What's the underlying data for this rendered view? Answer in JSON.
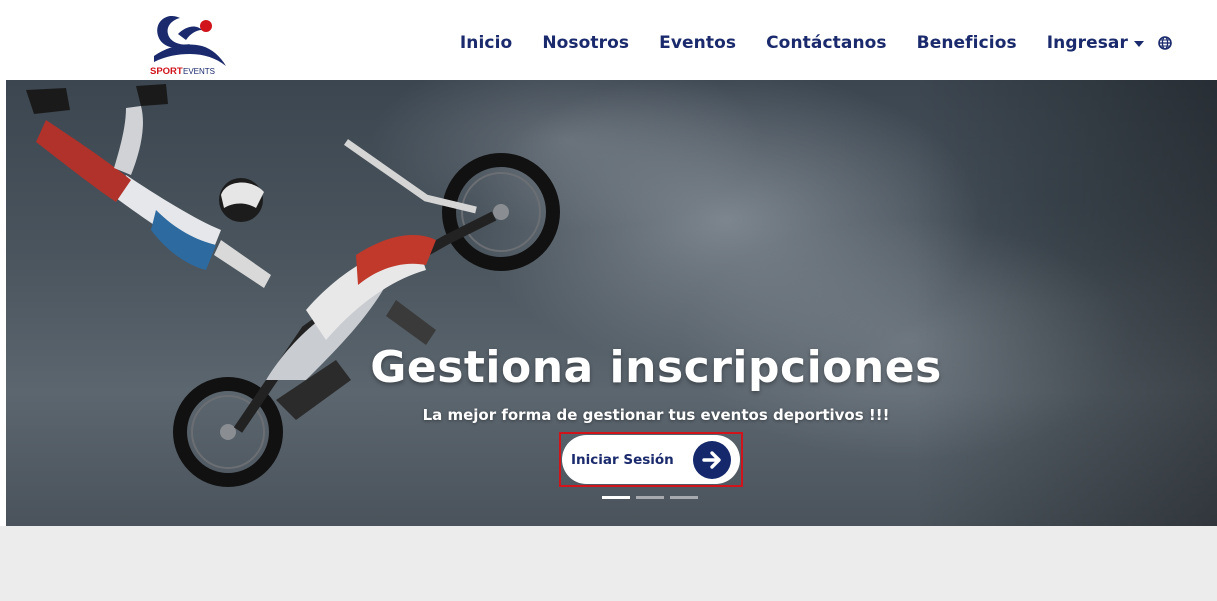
{
  "brand": {
    "logo_text_sport": "SPORT",
    "logo_text_events": "EVENTS",
    "colors": {
      "navy": "#1a2a6c",
      "red": "#d1141b"
    }
  },
  "nav": {
    "items": [
      {
        "label": "Inicio"
      },
      {
        "label": "Nosotros"
      },
      {
        "label": "Eventos"
      },
      {
        "label": "Contáctanos"
      },
      {
        "label": "Beneficios"
      },
      {
        "label": "Ingresar",
        "has_dropdown": true
      }
    ],
    "language_icon": "globe-icon"
  },
  "hero": {
    "title": "Gestiona inscripciones",
    "subtitle": "La mejor forma de gestionar tus eventos deportivos !!!",
    "cta_label": "Iniciar Sesión",
    "cta_icon": "arrow-right-circle-icon",
    "slides_count": 3,
    "active_slide": 1
  }
}
